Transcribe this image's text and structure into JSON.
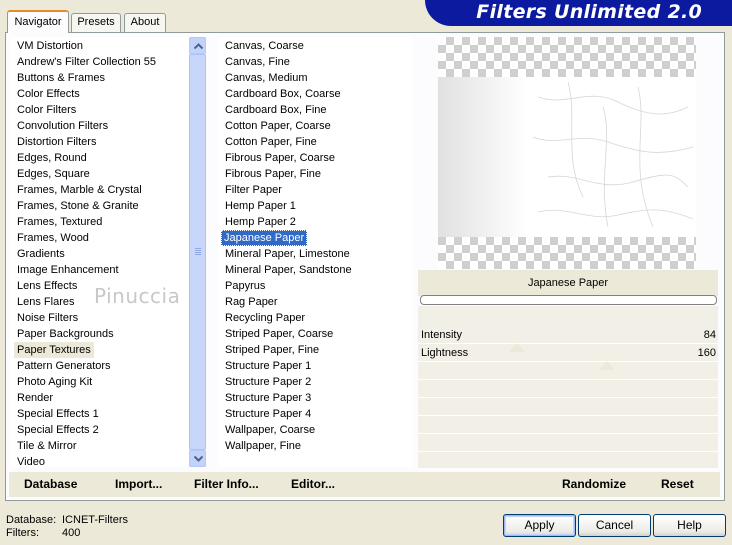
{
  "tabs": [
    {
      "label": "Navigator",
      "active": true
    },
    {
      "label": "Presets",
      "active": false
    },
    {
      "label": "About",
      "active": false
    }
  ],
  "banner": {
    "title": "Filters Unlimited 2.0"
  },
  "categories": {
    "items": [
      "VM Distortion",
      "Andrew's Filter Collection 55",
      "Buttons & Frames",
      "Color Effects",
      "Color Filters",
      "Convolution Filters",
      "Distortion Filters",
      "Edges, Round",
      "Edges, Square",
      "Frames, Marble & Crystal",
      "Frames, Stone & Granite",
      "Frames, Textured",
      "Frames, Wood",
      "Gradients",
      "Image Enhancement",
      "Lens Effects",
      "Lens Flares",
      "Noise Filters",
      "Paper Backgrounds",
      "Paper Textures",
      "Pattern Generators",
      "Photo Aging Kit",
      "Render",
      "Special Effects 1",
      "Special Effects 2",
      "Tile & Mirror",
      "Video"
    ],
    "selected": "Paper Textures"
  },
  "filters": {
    "items": [
      "Canvas, Coarse",
      "Canvas, Fine",
      "Canvas, Medium",
      "Cardboard Box, Coarse",
      "Cardboard Box, Fine",
      "Cotton Paper, Coarse",
      "Cotton Paper, Fine",
      "Fibrous Paper, Coarse",
      "Fibrous Paper, Fine",
      "Filter Paper",
      "Hemp Paper 1",
      "Hemp Paper 2",
      "Japanese Paper",
      "Mineral Paper, Limestone",
      "Mineral Paper, Sandstone",
      "Papyrus",
      "Rag Paper",
      "Recycling Paper",
      "Striped Paper, Coarse",
      "Striped Paper, Fine",
      "Structure Paper 1",
      "Structure Paper 2",
      "Structure Paper 3",
      "Structure Paper 4",
      "Wallpaper, Coarse",
      "Wallpaper, Fine"
    ],
    "selected": "Japanese Paper"
  },
  "watermark": "Pinuccia",
  "preview": {
    "filter_name": "Japanese Paper"
  },
  "params": [
    {
      "label": "Intensity",
      "value": "84",
      "fraction": 0.33
    },
    {
      "label": "Lightness",
      "value": "160",
      "fraction": 0.63
    }
  ],
  "toolbar": {
    "database": "Database",
    "import": "Import...",
    "filter_info": "Filter Info...",
    "editor": "Editor...",
    "randomize": "Randomize",
    "reset": "Reset"
  },
  "status": {
    "database_label": "Database:",
    "database_value": "ICNET-Filters",
    "filters_label": "Filters:",
    "filters_value": "400"
  },
  "buttons": {
    "apply": "Apply",
    "cancel": "Cancel",
    "help": "Help"
  },
  "colors": {
    "banner": "#0b1a9e",
    "selection": "#316ac5",
    "tab_accent": "#e68b2c"
  }
}
